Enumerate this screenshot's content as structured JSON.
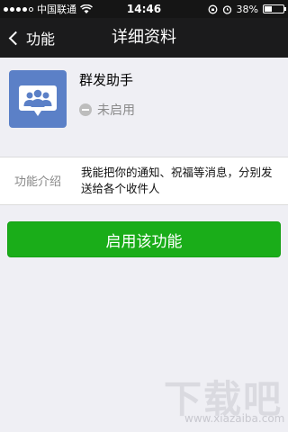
{
  "status_bar": {
    "carrier": "中国联通",
    "time": "14:46",
    "battery_percent": "38%",
    "battery_level": 0.38,
    "signal_bars_filled": 4,
    "signal_bars_total": 5
  },
  "nav": {
    "back_label": "功能",
    "title": "详细资料"
  },
  "feature": {
    "name": "群发助手",
    "status": "未启用",
    "icon": "group-chat-icon",
    "icon_color": "#5b80c7"
  },
  "intro": {
    "label": "功能介绍",
    "text": "我能把你的通知、祝福等消息，分别发送给各个收件人"
  },
  "actions": {
    "enable_label": "启用该功能",
    "enable_color": "#1aad19"
  },
  "watermark": {
    "logo": "下载吧",
    "url": "www.xiazaiba.com"
  }
}
